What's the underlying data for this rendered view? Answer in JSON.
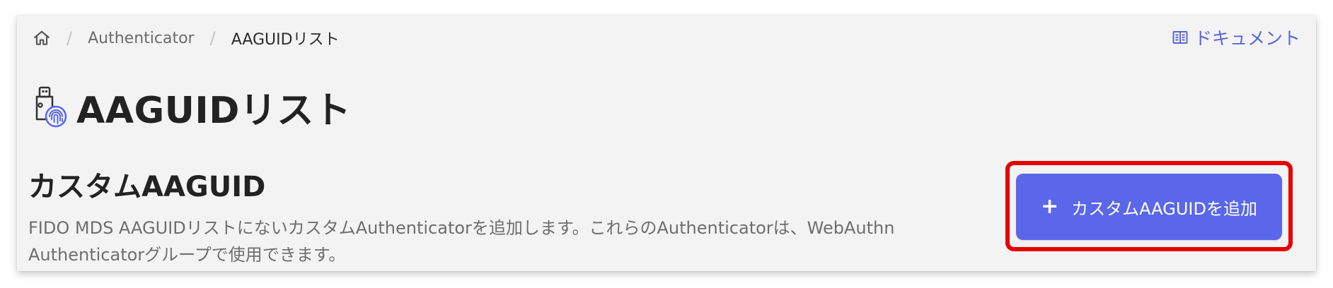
{
  "breadcrumb": {
    "home_icon": "home-icon",
    "separator": "/",
    "items": [
      {
        "label": "Authenticator"
      },
      {
        "label": "AAGUIDリスト"
      }
    ]
  },
  "doc_link": {
    "icon": "book-icon",
    "label": "ドキュメント"
  },
  "page": {
    "icon": "security-key-fingerprint-icon",
    "title": "AAGUIDリスト"
  },
  "section": {
    "title": "カスタムAAGUID",
    "description_line1": "FIDO MDS AAGUIDリストにないカスタムAuthenticatorを追加します。これらのAuthenticatorは、WebAuthn",
    "description_line2": "Authenticatorグループで使用できます。"
  },
  "add_button": {
    "icon": "plus-icon",
    "icon_glyph": "+",
    "label": "カスタムAAGUIDを追加"
  },
  "colors": {
    "accent": "#5a67e8",
    "link": "#5a67d8",
    "highlight": "#e60000",
    "panel_bg": "#f3f3f3"
  }
}
